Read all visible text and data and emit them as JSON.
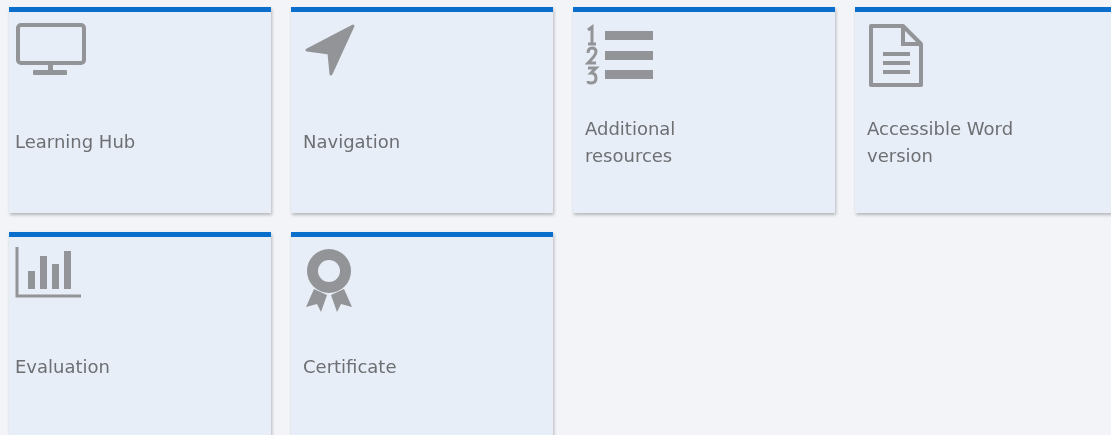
{
  "tiles": [
    {
      "label": "Learning Hub"
    },
    {
      "label": "Navigation"
    },
    {
      "label": "Additional\nresources"
    },
    {
      "label": "Accessible Word\nversion"
    },
    {
      "label": "Evaluation"
    },
    {
      "label": "Certificate"
    }
  ]
}
